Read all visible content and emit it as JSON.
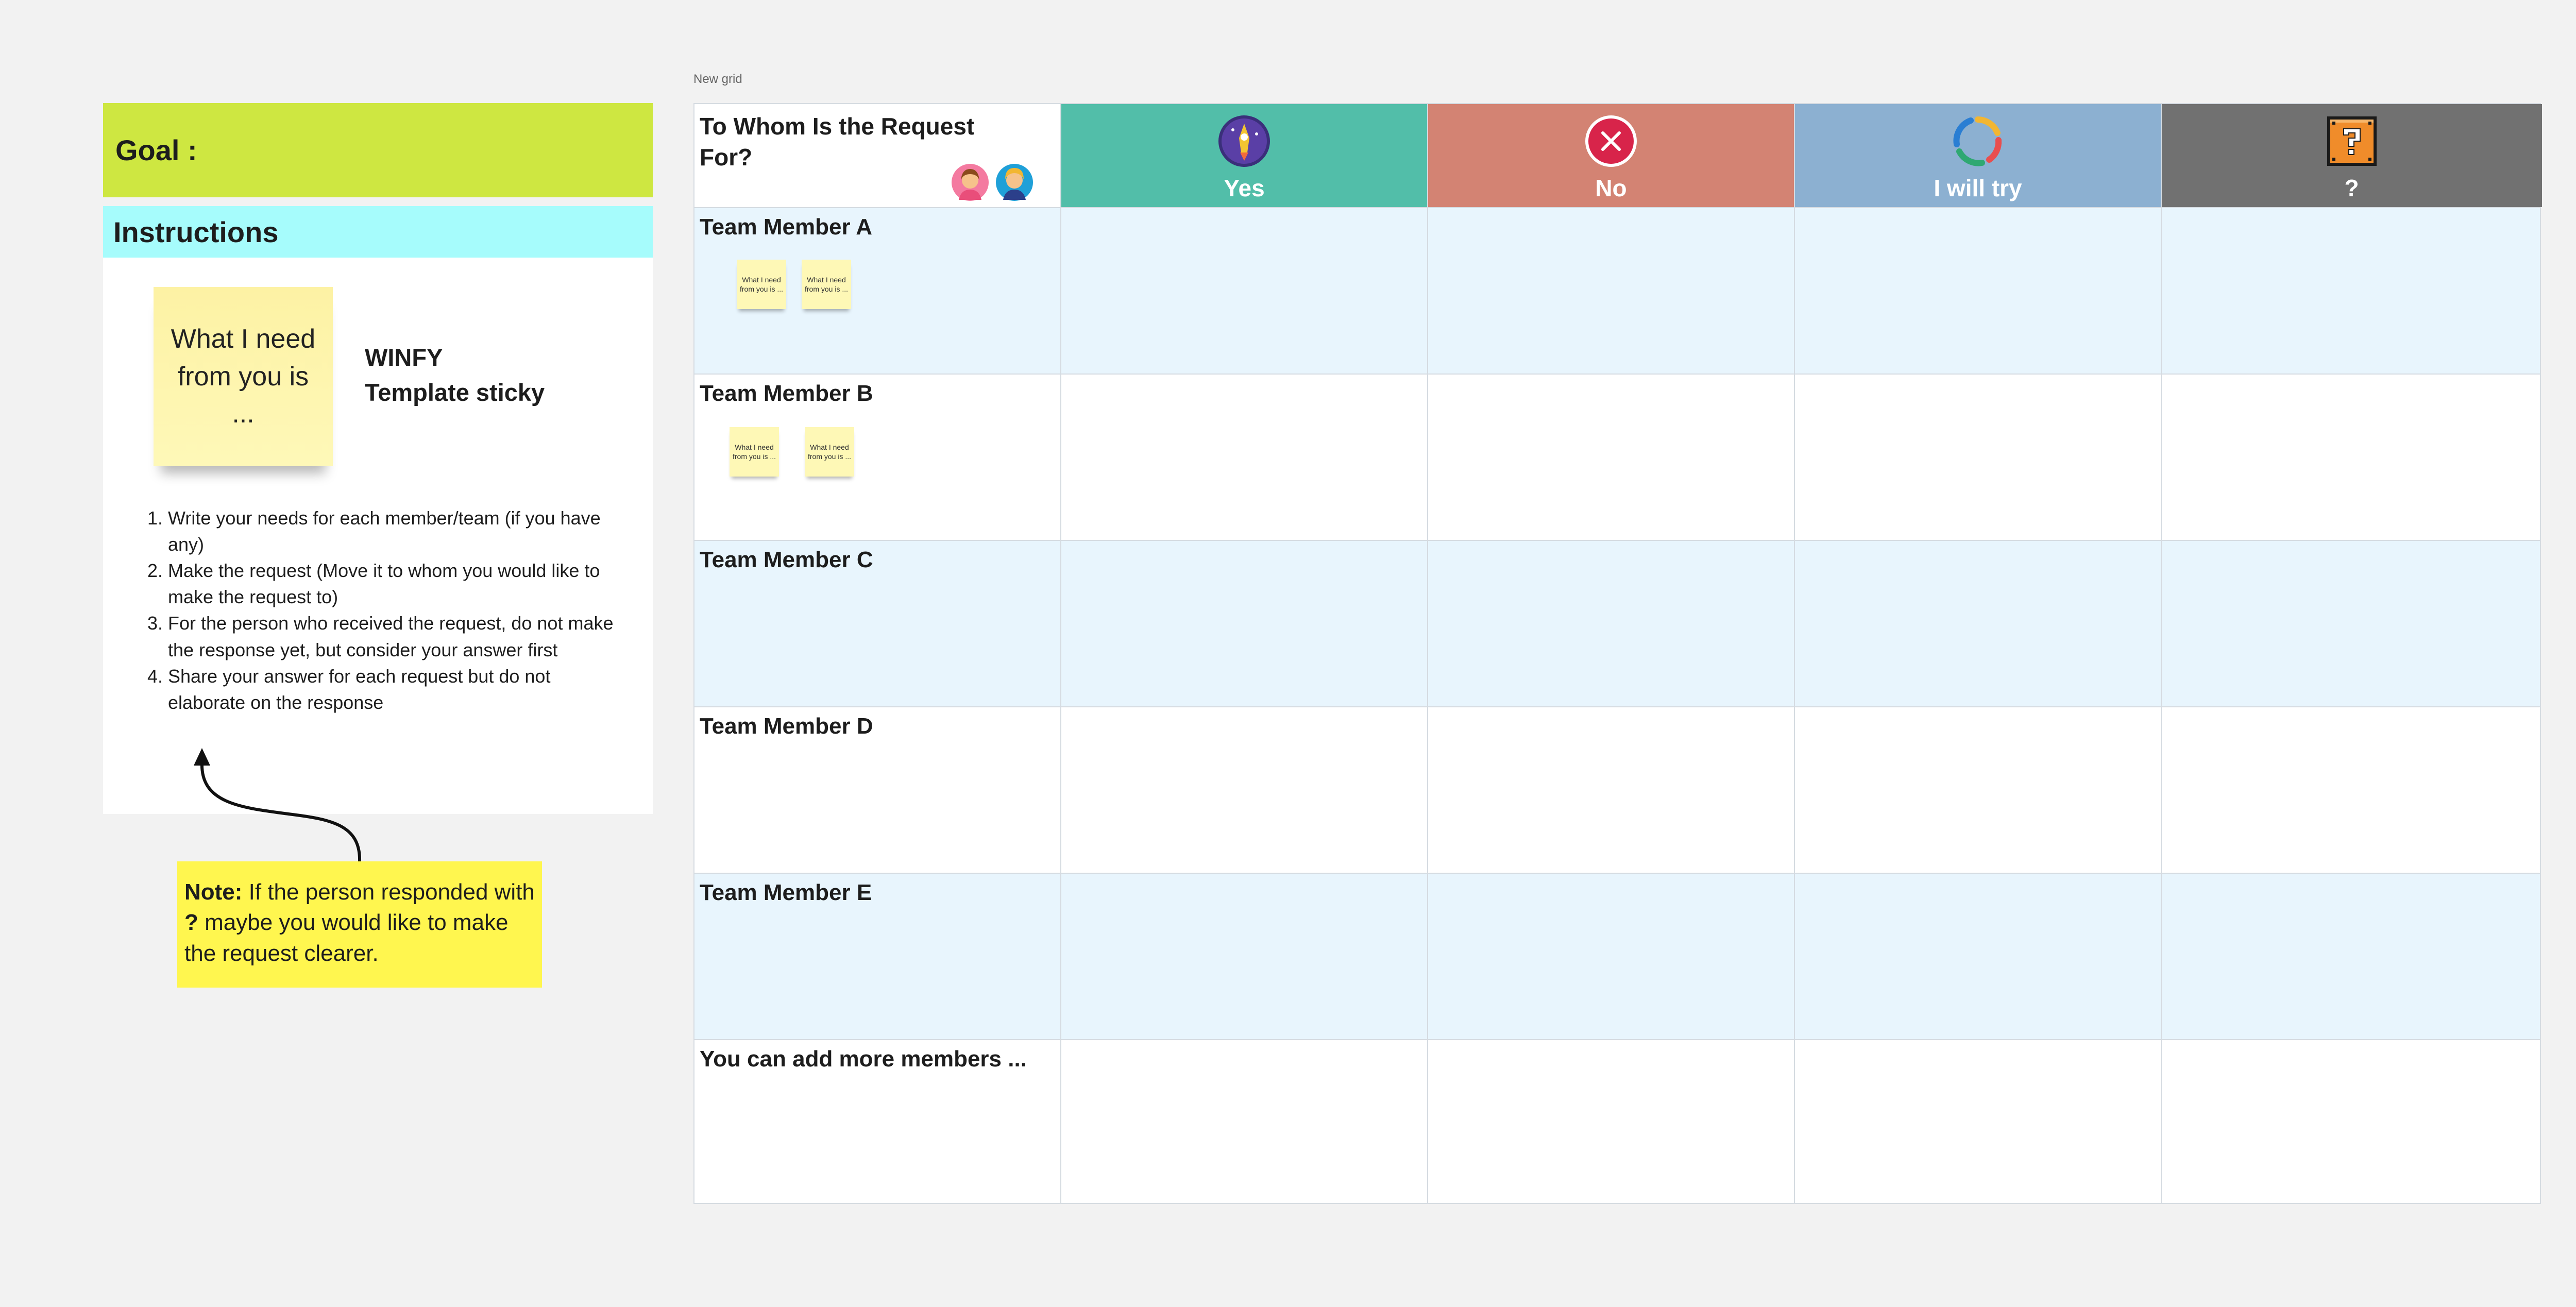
{
  "goal": {
    "label": "Goal :"
  },
  "instructions": {
    "title": "Instructions",
    "template_sticky_text": "What I need from you is ...",
    "winfy_line1": "WINFY",
    "winfy_line2": "Template sticky",
    "steps": [
      "Write your needs for each member/team (if you have any)",
      "Make the request (Move it to whom you would like to make the request to)",
      "For the person who received the request, do not make the response yet, but consider your answer first",
      "Share your answer for each request but do not elaborate on the response"
    ]
  },
  "note": {
    "bold": "Note:",
    "text_before": " If the person responded with",
    "bold_q": "?",
    "text_after": " maybe you would like to make the request clearer."
  },
  "grid": {
    "caption": "New grid",
    "corner_title": "To Whom Is the Request For?",
    "columns": [
      {
        "label": "Yes",
        "color": "#52bea9",
        "icon": "rocket-badge-icon"
      },
      {
        "label": "No",
        "color": "#d38373",
        "icon": "red-x-circle-icon"
      },
      {
        "label": "I will try",
        "color": "#8cb0d1",
        "icon": "colorful-ring-icon"
      },
      {
        "label": "?",
        "color": "#717171",
        "icon": "question-block-icon"
      }
    ],
    "rows": [
      {
        "label": "Team Member A"
      },
      {
        "label": "Team Member B"
      },
      {
        "label": "Team Member C"
      },
      {
        "label": "Team Member D"
      },
      {
        "label": "Team Member E"
      },
      {
        "label": "You can add more members ..."
      }
    ],
    "mini_sticky_text": "What I need from you is ..."
  }
}
